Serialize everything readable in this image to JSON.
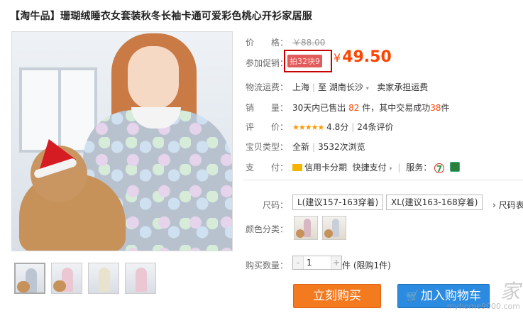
{
  "product": {
    "title": "【淘牛品】珊瑚绒睡衣女套装秋冬长袖卡通可爱彩色桃心开衫家居服"
  },
  "gallery": {
    "thumbnails": [
      "thumb-1",
      "thumb-2",
      "thumb-3",
      "thumb-4"
    ]
  },
  "price": {
    "label": "价　　格：",
    "original": "￥88.00",
    "promo_label": "参加促销：",
    "promo_tag": "拍32块9",
    "currency": "¥",
    "current": "49.50"
  },
  "shipping": {
    "label": "物流运费：",
    "from": "上海",
    "to_prefix": "至",
    "to": "湖南长沙",
    "note": "卖家承担运费"
  },
  "sales": {
    "label": "销　　量：",
    "prefix": "30天内已售出",
    "sold": "82",
    "mid": "件，其中交易成功",
    "success": "38",
    "suffix": "件"
  },
  "rating": {
    "label": "评　　价：",
    "stars": "★★★★★",
    "score": "4.8分",
    "reviews": "24条评价"
  },
  "condition": {
    "label": "宝贝类型：",
    "value": "全新",
    "views": "3532次浏览"
  },
  "payment": {
    "label": "支　　付：",
    "credit": "信用卡分期",
    "quick": "快捷支付",
    "service_label": "服务：",
    "service_7": "7"
  },
  "options": {
    "size_label": "尺码：",
    "sizes": [
      "L(建议157-163穿着)",
      "XL(建议163-168穿着)"
    ],
    "size_chart": "尺码表",
    "color_label": "颜色分类：",
    "quantity_label": "购买数量：",
    "quantity_value": "1",
    "minus": "-",
    "plus": "+",
    "quantity_note": "件 (限购1件)"
  },
  "actions": {
    "buy_now": "立刻购买",
    "add_to_cart": "加入购物车"
  },
  "watermark": {
    "text": "家",
    "url": "myhome9000.com"
  },
  "colors": {
    "accent": "#f40",
    "buy": "#f47a20",
    "cart": "#2b8be0",
    "promo_border": "#c80000"
  }
}
